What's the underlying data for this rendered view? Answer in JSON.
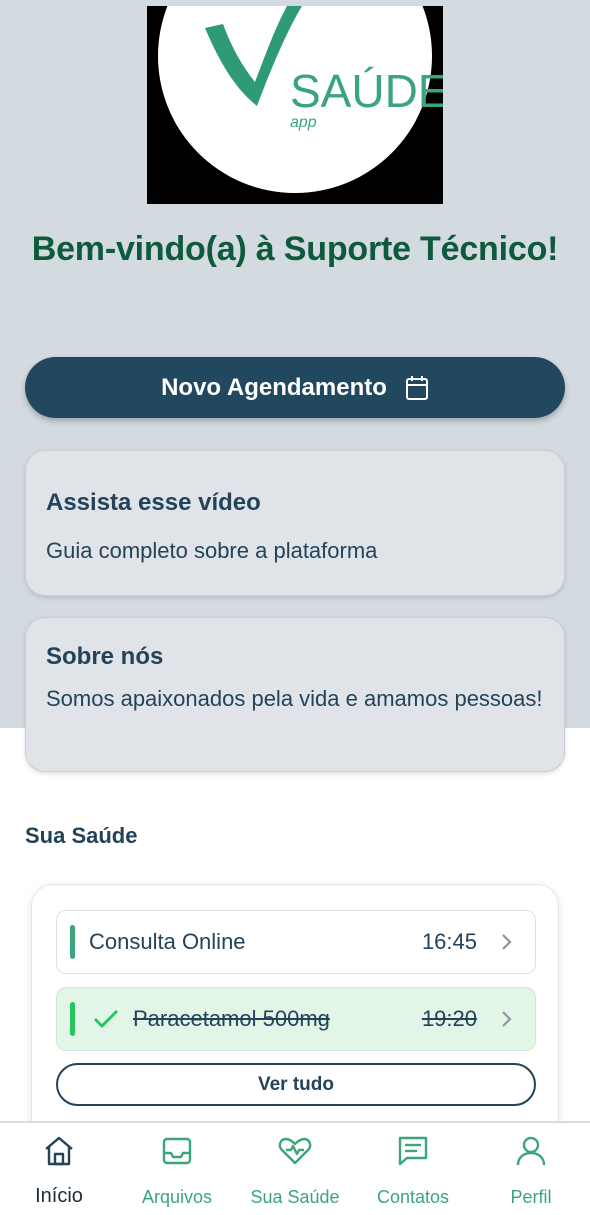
{
  "logo": {
    "brand": "SAÚDE",
    "sub": "app"
  },
  "welcome": "Bem-vindo(a) à Suporte Técnico!",
  "new_appointment": {
    "label": "Novo Agendamento",
    "icon": "calendar-icon"
  },
  "cards": [
    {
      "title": "Assista esse vídeo",
      "text": "Guia completo sobre a plataforma"
    },
    {
      "title": "Sobre nós",
      "text": "Somos apaixonados pela vida e amamos pessoas!"
    }
  ],
  "health": {
    "title": "Sua Saúde",
    "items": [
      {
        "name": "Consulta Online",
        "time": "16:45",
        "done": false
      },
      {
        "name": "Paracetamol 500mg",
        "time": "19:20",
        "done": true
      }
    ],
    "view_all": "Ver tudo"
  },
  "nav": [
    {
      "label": "Início",
      "icon": "home-icon",
      "active": true
    },
    {
      "label": "Arquivos",
      "icon": "inbox-icon",
      "active": false
    },
    {
      "label": "Sua Saúde",
      "icon": "heart-pulse-icon",
      "active": false
    },
    {
      "label": "Contatos",
      "icon": "message-icon",
      "active": false
    },
    {
      "label": "Perfil",
      "icon": "user-icon",
      "active": false
    }
  ],
  "colors": {
    "primary": "#22485f",
    "accent": "#3aa57a",
    "title_green": "#0e5a3c",
    "hero_bg": "#d3dae0"
  }
}
